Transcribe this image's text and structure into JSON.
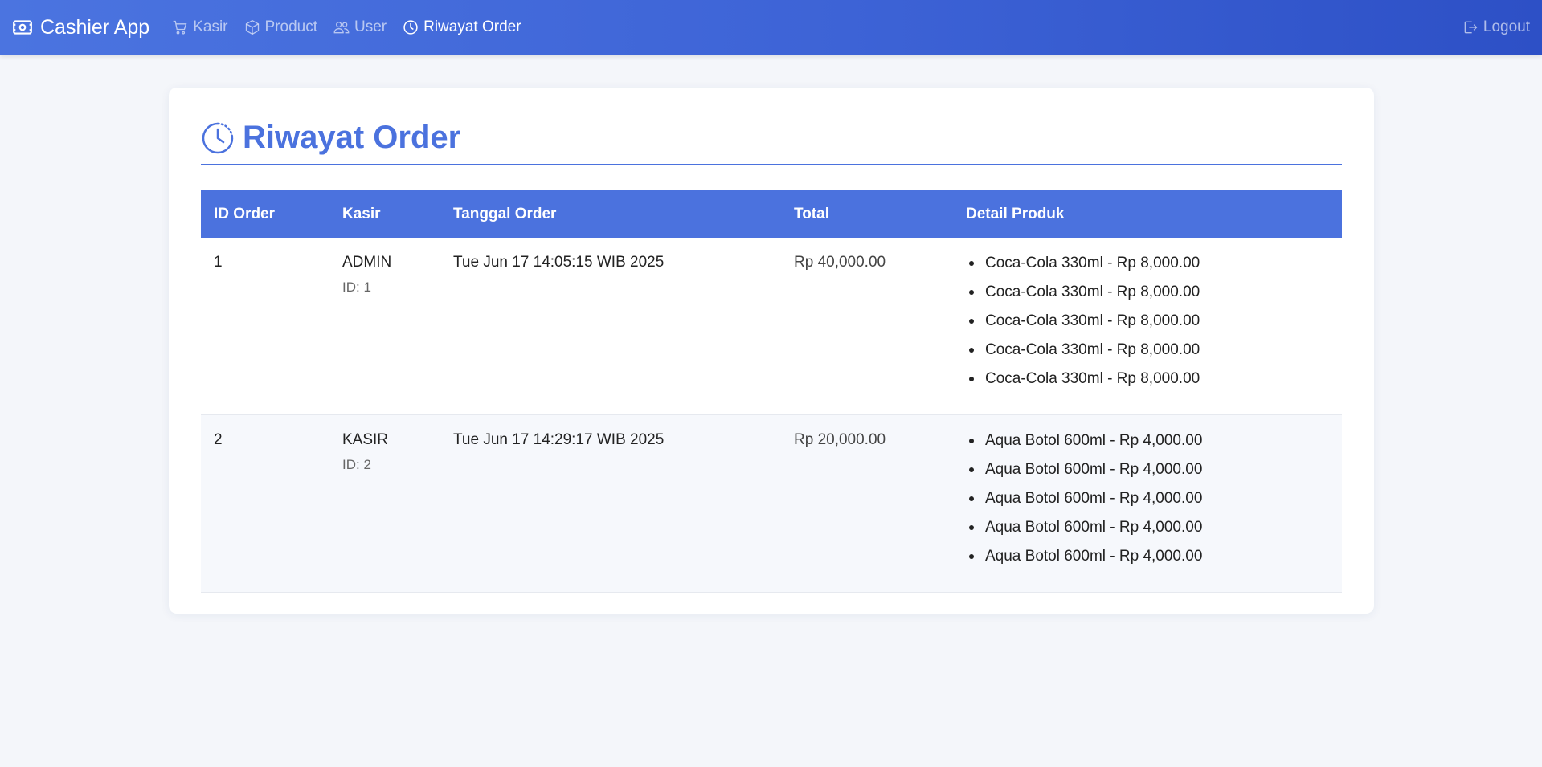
{
  "nav": {
    "brand": "Cashier App",
    "links": [
      {
        "label": "Kasir",
        "icon": "cart-icon"
      },
      {
        "label": "Product",
        "icon": "box-icon"
      },
      {
        "label": "User",
        "icon": "users-icon"
      },
      {
        "label": "Riwayat Order",
        "icon": "clock-icon"
      }
    ],
    "logout": "Logout"
  },
  "page": {
    "title": "Riwayat Order"
  },
  "table": {
    "headers": [
      "ID Order",
      "Kasir",
      "Tanggal Order",
      "Total",
      "Detail Produk"
    ],
    "rows": [
      {
        "id": "1",
        "kasir": "ADMIN",
        "kasir_id": "ID: 1",
        "date": "Tue Jun 17 14:05:15 WIB 2025",
        "total": "Rp 40,000.00",
        "items": [
          "Coca-Cola 330ml - Rp 8,000.00",
          "Coca-Cola 330ml - Rp 8,000.00",
          "Coca-Cola 330ml - Rp 8,000.00",
          "Coca-Cola 330ml - Rp 8,000.00",
          "Coca-Cola 330ml - Rp 8,000.00"
        ]
      },
      {
        "id": "2",
        "kasir": "KASIR",
        "kasir_id": "ID: 2",
        "date": "Tue Jun 17 14:29:17 WIB 2025",
        "total": "Rp 20,000.00",
        "items": [
          "Aqua Botol 600ml - Rp 4,000.00",
          "Aqua Botol 600ml - Rp 4,000.00",
          "Aqua Botol 600ml - Rp 4,000.00",
          "Aqua Botol 600ml - Rp 4,000.00",
          "Aqua Botol 600ml - Rp 4,000.00"
        ]
      }
    ]
  },
  "colors": {
    "accent": "#4b72de",
    "nav_gradient_start": "#4b74e0",
    "nav_gradient_end": "#2d50c6",
    "background": "#f4f6fa"
  }
}
